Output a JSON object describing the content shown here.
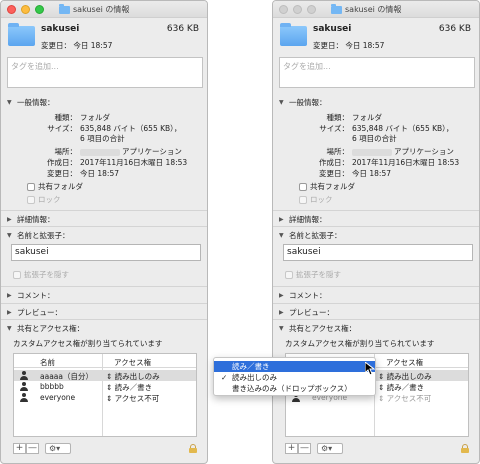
{
  "window": {
    "title": "sakusei の情報",
    "name": "sakusei",
    "size": "636 KB",
    "modified": "変更日： 今日 18:57",
    "tags_placeholder": "タグを追加..."
  },
  "general": {
    "header": "一般情報：",
    "kind_label": "種類：",
    "kind": "フォルダ",
    "size_label": "サイズ：",
    "size_line1": "635,848 バイト（655 KB），",
    "size_line2": "6 項目の合計",
    "where_label": "場所：",
    "where": "アプリケーション",
    "created_label": "作成日：",
    "created": "2017年11月16日木曜日 18:53",
    "modified_label": "変更日：",
    "modified": "今日 18:57",
    "shared_folder": "共有フォルダ",
    "locked": "ロック"
  },
  "more_info": {
    "header": "詳細情報："
  },
  "name_ext": {
    "header": "名前と拡張子：",
    "value": "sakusei",
    "hide_ext": "拡張子を隠す"
  },
  "comments": {
    "header": "コメント："
  },
  "preview": {
    "header": "プレビュー："
  },
  "sharing": {
    "header": "共有とアクセス権：",
    "note": "カスタムアクセス権が割り当てられています",
    "col_name": "名前",
    "col_priv": "アクセス権",
    "rows": [
      {
        "name": "aaaaa（自分）",
        "priv": "読み出しのみ"
      },
      {
        "name": "bbbbb",
        "priv": "読み／書き"
      },
      {
        "name": "everyone",
        "priv": "アクセス不可"
      }
    ],
    "add": "+",
    "remove": "—",
    "gear": "⚙▾"
  },
  "menu": {
    "items": [
      {
        "label": "読み／書き",
        "highlighted": true,
        "checked": false
      },
      {
        "label": "読み出しのみ",
        "highlighted": false,
        "checked": true
      },
      {
        "label": "書き込みのみ（ドロップボックス）",
        "highlighted": false,
        "checked": false
      }
    ],
    "check": "✓"
  },
  "colors": {
    "highlight": "#2e6fdb",
    "folder": "#5ba5ef"
  }
}
